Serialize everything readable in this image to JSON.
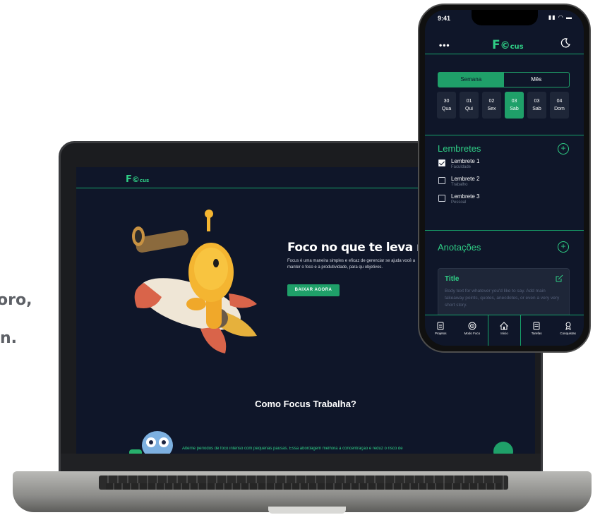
{
  "background_fragments": [
    "oro,",
    "n."
  ],
  "laptop": {
    "logo": {
      "main": "F",
      "mark": "cus"
    },
    "hero": {
      "title": "Foco no que te leva ma",
      "body": "Focus é uma maneira simples e eficaz de gerenciar se ajuda você a manter o foco e a produtividade, para qu objetivos.",
      "button": "BAIXAR AGORA"
    },
    "how": {
      "title": "Como Focus Trabalha?",
      "body": "Alterne períodos de foco intenso com pequenas pausas. Essa abordagem melhora a concentração e reduz o risco de"
    },
    "icons": [
      "mascot-rocket-telescope",
      "owl-icon",
      "chat-icon"
    ]
  },
  "phone": {
    "status": {
      "time": "9:41",
      "icons": "signal wifi battery"
    },
    "header": {
      "logo_main": "F",
      "logo_mark": "cus",
      "menu": "•••"
    },
    "period_tabs": [
      {
        "label": "Semana",
        "active": true
      },
      {
        "label": "Mês",
        "active": false
      }
    ],
    "days": [
      {
        "num": "30",
        "name": "Qua",
        "active": false
      },
      {
        "num": "01",
        "name": "Qui",
        "active": false
      },
      {
        "num": "02",
        "name": "Sex",
        "active": false
      },
      {
        "num": "03",
        "name": "Sab",
        "active": true
      },
      {
        "num": "03",
        "name": "Sab",
        "active": false
      },
      {
        "num": "04",
        "name": "Dom",
        "active": false
      }
    ],
    "reminders": {
      "title": "Lembretes",
      "add": "+",
      "items": [
        {
          "title": "Lembrete 1",
          "sub": "Faculdade",
          "checked": true
        },
        {
          "title": "Lembrete 2",
          "sub": "Trabalho",
          "checked": false
        },
        {
          "title": "Lembrete 3",
          "sub": "Pessoal",
          "checked": false
        }
      ]
    },
    "notes": {
      "title": "Anotações",
      "add": "+",
      "card": {
        "title": "Title",
        "body": "Body text for whatever you'd like to say. Add main takeaway points, quotes, anecdotes, or even a very very short story."
      }
    },
    "tabs": [
      {
        "label": "Projetos",
        "icon": "document-icon"
      },
      {
        "label": "Modo Foco",
        "icon": "target-icon"
      },
      {
        "label": "Inicio",
        "icon": "home-icon",
        "active": true
      },
      {
        "label": "Tarefas",
        "icon": "list-icon"
      },
      {
        "label": "Conquistas",
        "icon": "medal-icon"
      }
    ]
  },
  "colors": {
    "accent": "#1fa069",
    "accent_light": "#2fcf86",
    "screen_bg": "#0f1629",
    "card_bg": "#1e2638"
  }
}
